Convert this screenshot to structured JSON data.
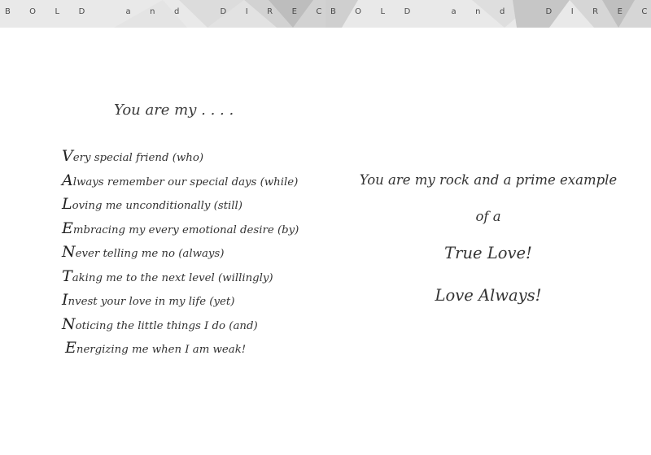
{
  "header": {
    "banner_text_left": "BOLD and DIRECT",
    "banner_text_right": "BOLD and DIRECT",
    "banner_bg": "#e9e9e9",
    "shade_light": "#dcdcdc",
    "shade_dark": "#bdbdbd"
  },
  "poem": {
    "title": "You are my . . . .",
    "lines": [
      {
        "cap": "V",
        "rest": "ery special friend (who)"
      },
      {
        "cap": "A",
        "rest": "lways remember our special days (while)"
      },
      {
        "cap": "L",
        "rest": "oving me unconditionally (still)"
      },
      {
        "cap": "E",
        "rest": "mbracing my every emotional desire (by)"
      },
      {
        "cap": "N",
        "rest": "ever telling me no (always)"
      },
      {
        "cap": "T",
        "rest": "aking me to the next level (willingly)"
      },
      {
        "cap": "I",
        "rest": "nvest your love in my life (yet)"
      },
      {
        "cap": "N",
        "rest": "oticing the little things I do (and)"
      },
      {
        "cap": "E",
        "rest": "nergizing me when I am weak!"
      }
    ]
  },
  "message": {
    "line1": "You are my rock and a prime example",
    "line2": "of  a",
    "line3": "True Love!",
    "line4": "Love Always!"
  }
}
